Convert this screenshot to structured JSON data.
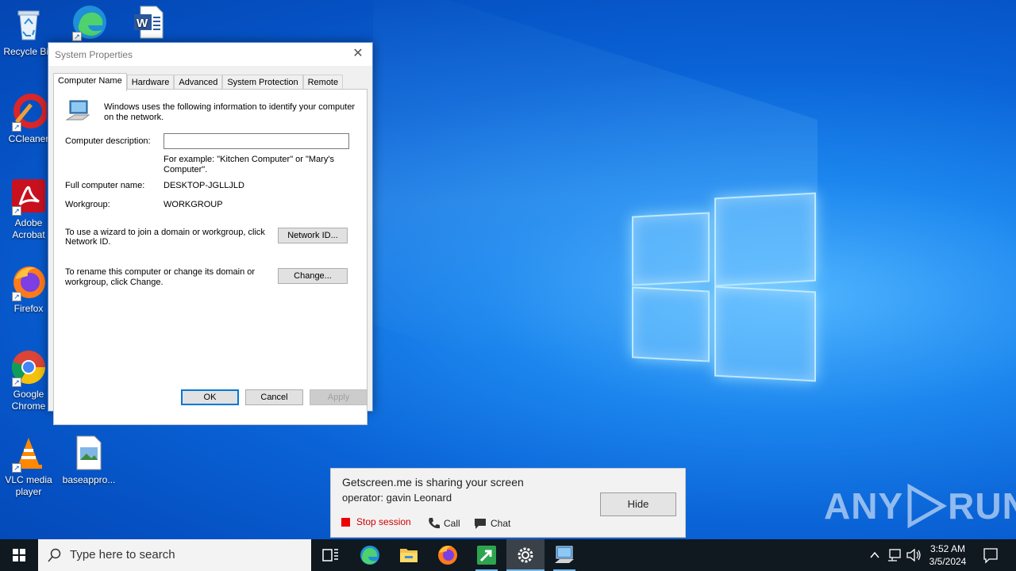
{
  "desktop": {
    "icons": [
      {
        "label": "Recycle Bin",
        "icon": "recycle-bin-icon"
      },
      {
        "label": "",
        "icon": "edge-icon"
      },
      {
        "label": "",
        "icon": "word-document-icon"
      },
      {
        "label": "CCleaner",
        "icon": "ccleaner-icon"
      },
      {
        "label": "Adobe Acrobat",
        "icon": "adobe-acrobat-icon"
      },
      {
        "label": "Firefox",
        "icon": "firefox-icon"
      },
      {
        "label": "Google Chrome",
        "icon": "chrome-icon"
      },
      {
        "label": "VLC media player",
        "icon": "vlc-icon"
      },
      {
        "label": "baseappro...",
        "icon": "image-file-icon"
      }
    ]
  },
  "dialog": {
    "title": "System Properties",
    "tabs": [
      {
        "label": "Computer Name",
        "active": true
      },
      {
        "label": "Hardware"
      },
      {
        "label": "Advanced"
      },
      {
        "label": "System Protection"
      },
      {
        "label": "Remote"
      }
    ],
    "intro_line1": "Windows uses the following information to identify your computer",
    "intro_line2": "on the network.",
    "description_label": "Computer description:",
    "description_value": "",
    "example_line1": "For example: \"Kitchen Computer\" or \"Mary's",
    "example_line2": "Computer\".",
    "full_name_label": "Full computer name:",
    "full_name_value": "DESKTOP-JGLLJLD",
    "workgroup_label": "Workgroup:",
    "workgroup_value": "WORKGROUP",
    "wizard_line1": "To use a wizard to join a domain or workgroup, click",
    "wizard_line2": "Network ID.",
    "network_id_button": "Network ID...",
    "rename_line1": "To rename this computer or change its domain or",
    "rename_line2": "workgroup, click Change.",
    "change_button": "Change...",
    "ok_button": "OK",
    "cancel_button": "Cancel",
    "apply_button": "Apply"
  },
  "share_popup": {
    "line1": "Getscreen.me is sharing your screen",
    "line2": "operator: gavin Leonard",
    "hide_button": "Hide",
    "stop_session": "Stop session",
    "call": "Call",
    "chat": "Chat"
  },
  "watermark": {
    "text_left": "ANY",
    "text_right": "RUN"
  },
  "taskbar": {
    "search_placeholder": "Type here to search",
    "time": "3:52 AM",
    "date": "3/5/2024",
    "pinned": [
      "task-view-icon",
      "edge-icon",
      "file-explorer-icon",
      "firefox-icon",
      "getscreen-icon",
      "settings-icon",
      "system-properties-icon"
    ]
  },
  "colors": {
    "accent": "#0078d7",
    "taskbar": "#101820",
    "stop": "#e00000"
  }
}
